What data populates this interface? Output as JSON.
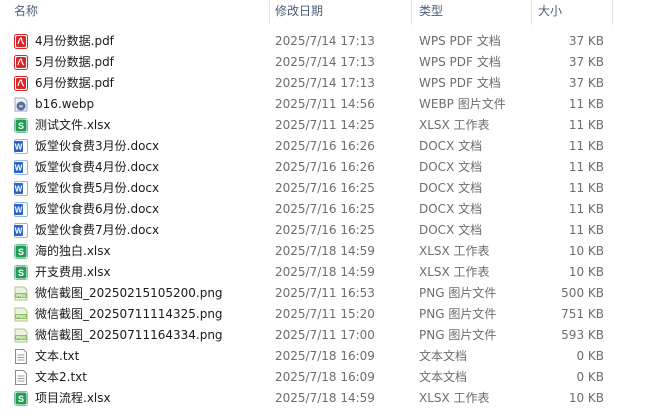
{
  "columns": {
    "name": "名称",
    "date": "修改日期",
    "type": "类型",
    "size": "大小"
  },
  "files": [
    {
      "name": "4月份数据.pdf",
      "date": "2025/7/14 17:13",
      "type": "WPS PDF 文档",
      "size": "37 KB",
      "icon": "pdf-file-icon"
    },
    {
      "name": "5月份数据.pdf",
      "date": "2025/7/14 17:13",
      "type": "WPS PDF 文档",
      "size": "37 KB",
      "icon": "pdf-file-icon"
    },
    {
      "name": "6月份数据.pdf",
      "date": "2025/7/14 17:13",
      "type": "WPS PDF 文档",
      "size": "37 KB",
      "icon": "pdf-file-icon"
    },
    {
      "name": "b16.webp",
      "date": "2025/7/11 14:56",
      "type": "WEBP 图片文件",
      "size": "11 KB",
      "icon": "webp-file-icon"
    },
    {
      "name": "测试文件.xlsx",
      "date": "2025/7/11 14:25",
      "type": "XLSX 工作表",
      "size": "11 KB",
      "icon": "xlsx-file-icon"
    },
    {
      "name": "饭堂伙食费3月份.docx",
      "date": "2025/7/16 16:26",
      "type": "DOCX 文档",
      "size": "11 KB",
      "icon": "docx-file-icon"
    },
    {
      "name": "饭堂伙食费4月份.docx",
      "date": "2025/7/16 16:26",
      "type": "DOCX 文档",
      "size": "11 KB",
      "icon": "docx-file-icon"
    },
    {
      "name": "饭堂伙食费5月份.docx",
      "date": "2025/7/16 16:25",
      "type": "DOCX 文档",
      "size": "11 KB",
      "icon": "docx-file-icon"
    },
    {
      "name": "饭堂伙食费6月份.docx",
      "date": "2025/7/16 16:25",
      "type": "DOCX 文档",
      "size": "11 KB",
      "icon": "docx-file-icon"
    },
    {
      "name": "饭堂伙食费7月份.docx",
      "date": "2025/7/16 16:25",
      "type": "DOCX 文档",
      "size": "11 KB",
      "icon": "docx-file-icon"
    },
    {
      "name": "海的独白.xlsx",
      "date": "2025/7/18 14:59",
      "type": "XLSX 工作表",
      "size": "10 KB",
      "icon": "xlsx-file-icon"
    },
    {
      "name": "开支费用.xlsx",
      "date": "2025/7/18 14:59",
      "type": "XLSX 工作表",
      "size": "10 KB",
      "icon": "xlsx-file-icon"
    },
    {
      "name": "微信截图_20250215105200.png",
      "date": "2025/7/11 16:53",
      "type": "PNG 图片文件",
      "size": "500 KB",
      "icon": "png-file-icon"
    },
    {
      "name": "微信截图_20250711114325.png",
      "date": "2025/7/11 15:20",
      "type": "PNG 图片文件",
      "size": "751 KB",
      "icon": "png-file-icon"
    },
    {
      "name": "微信截图_20250711164334.png",
      "date": "2025/7/11 17:00",
      "type": "PNG 图片文件",
      "size": "593 KB",
      "icon": "png-file-icon"
    },
    {
      "name": "文本.txt",
      "date": "2025/7/18 16:09",
      "type": "文本文档",
      "size": "0 KB",
      "icon": "txt-file-icon"
    },
    {
      "name": "文本2.txt",
      "date": "2025/7/18 16:09",
      "type": "文本文档",
      "size": "0 KB",
      "icon": "txt-file-icon"
    },
    {
      "name": "项目流程.xlsx",
      "date": "2025/7/18 14:59",
      "type": "XLSX 工作表",
      "size": "10 KB",
      "icon": "xlsx-file-icon"
    }
  ],
  "colors": {
    "pdf": "#d9262b",
    "docx": "#2b63c6",
    "xlsx": "#1f9d55",
    "png": "#8bbf62",
    "webp": "#5a6f96",
    "txt": "#8a8a8a"
  }
}
